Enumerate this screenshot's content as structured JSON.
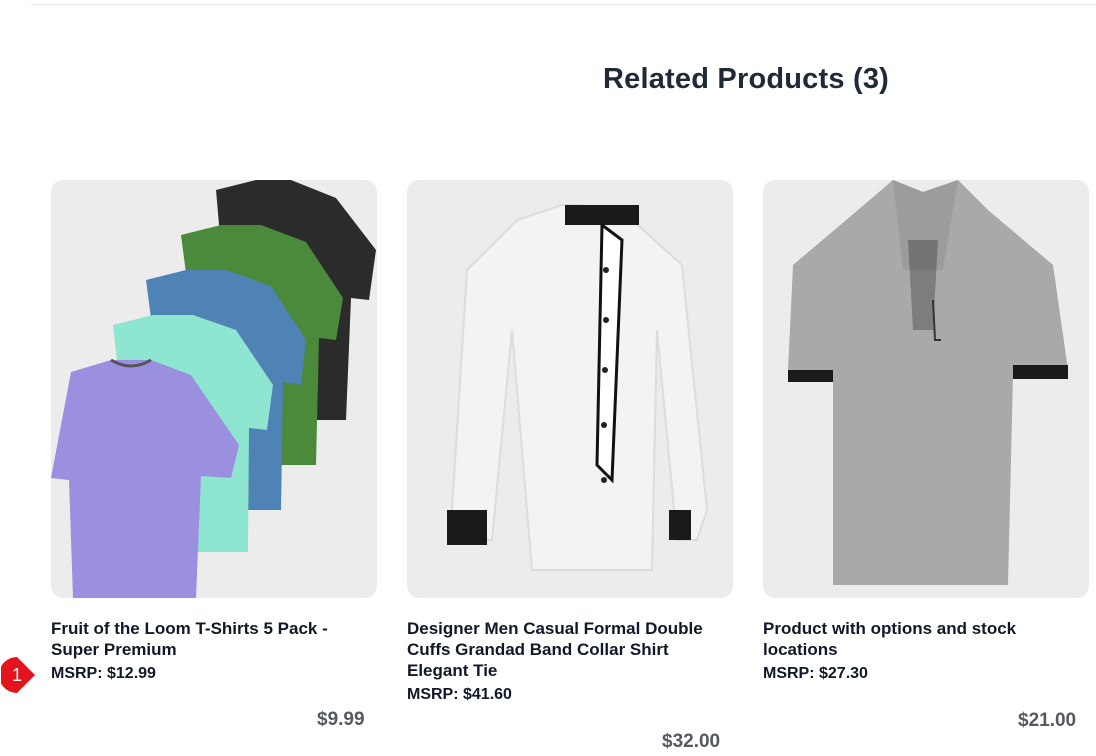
{
  "section": {
    "title": "Related Products (3)"
  },
  "badge": {
    "number": "1",
    "color": "#e3141b"
  },
  "products": [
    {
      "title": "Fruit of the Loom T-Shirts 5 Pack - Super Premium",
      "msrp": "MSRP: $12.99",
      "price": "$9.99"
    },
    {
      "title": "Designer Men Casual Formal Double Cuffs Grandad Band Collar Shirt Elegant Tie",
      "msrp": "MSRP: $41.60",
      "price": "$32.00"
    },
    {
      "title": "Product with options and stock locations",
      "msrp": "MSRP: $27.30",
      "price": "$21.00"
    }
  ]
}
